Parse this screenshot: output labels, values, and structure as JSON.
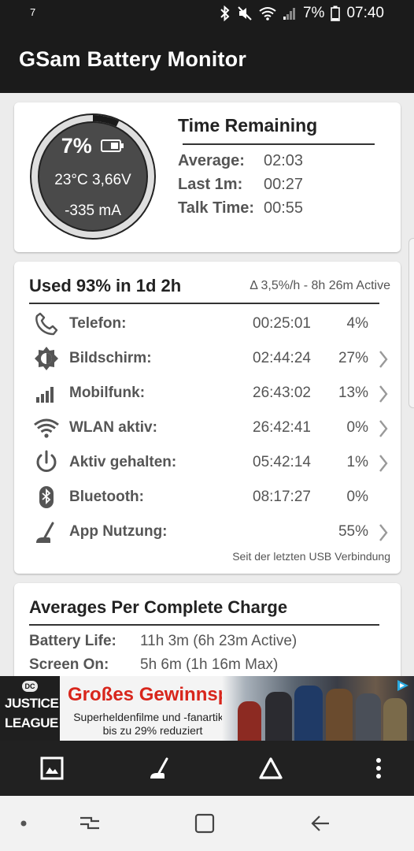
{
  "status_bar": {
    "notification": "7",
    "battery_percent": "7%",
    "time": "07:40"
  },
  "app": {
    "title": "GSam Battery Monitor"
  },
  "gauge": {
    "percent": "7%",
    "level_fraction": 0.07,
    "temp_volt": "23°C  3,66V",
    "current": "-335 mA"
  },
  "time_remaining": {
    "title": "Time Remaining",
    "rows": [
      {
        "label": "Average:",
        "value": "02:03"
      },
      {
        "label": "Last 1m:",
        "value": "00:27"
      },
      {
        "label": "Talk Time:",
        "value": "00:55"
      }
    ]
  },
  "usage": {
    "title": "Used 93% in 1d 2h",
    "rate": "Δ 3,5%/h - 8h 26m Active",
    "rows": [
      {
        "icon": "phone-icon",
        "label": "Telefon:",
        "time": "00:25:01",
        "pct": "4%",
        "chevron": false
      },
      {
        "icon": "brightness-icon",
        "label": "Bildschirm:",
        "time": "02:44:24",
        "pct": "27%",
        "chevron": true
      },
      {
        "icon": "signal-bars-icon",
        "label": "Mobilfunk:",
        "time": "26:43:02",
        "pct": "13%",
        "chevron": true
      },
      {
        "icon": "wifi-icon",
        "label": "WLAN aktiv:",
        "time": "26:42:41",
        "pct": "0%",
        "chevron": true
      },
      {
        "icon": "power-icon",
        "label": "Aktiv gehalten:",
        "time": "05:42:14",
        "pct": "1%",
        "chevron": true
      },
      {
        "icon": "bluetooth-icon",
        "label": "Bluetooth:",
        "time": "08:17:27",
        "pct": "0%",
        "chevron": false
      },
      {
        "icon": "app-usage-icon",
        "label": "App Nutzung:",
        "time": "",
        "pct": "55%",
        "chevron": true
      }
    ],
    "footnote": "Seit der letzten USB Verbindung"
  },
  "averages": {
    "title": "Averages Per Complete Charge",
    "rows": [
      {
        "label": "Battery Life:",
        "value": "11h 3m (6h 23m Active)"
      },
      {
        "label": "Screen On:",
        "value": "5h 6m (1h 16m Max)"
      }
    ]
  },
  "ad": {
    "brand_badge": "DC",
    "brand_line1": "JUSTICE",
    "brand_line2": "LEAGUE",
    "headline": "Großes Gewinnspiel",
    "sub1": "Superheldenfilme und -fanartikel",
    "sub2": "bis zu 29% reduziert"
  },
  "toolbar": [
    "image-icon",
    "app-usage-icon",
    "triangle-icon",
    "more-vert-icon"
  ],
  "colors": {
    "bar": "#1b1b1b",
    "gauge_fill": "#4a4a4a",
    "card": "#ffffff",
    "ad_red": "#d8261c"
  }
}
